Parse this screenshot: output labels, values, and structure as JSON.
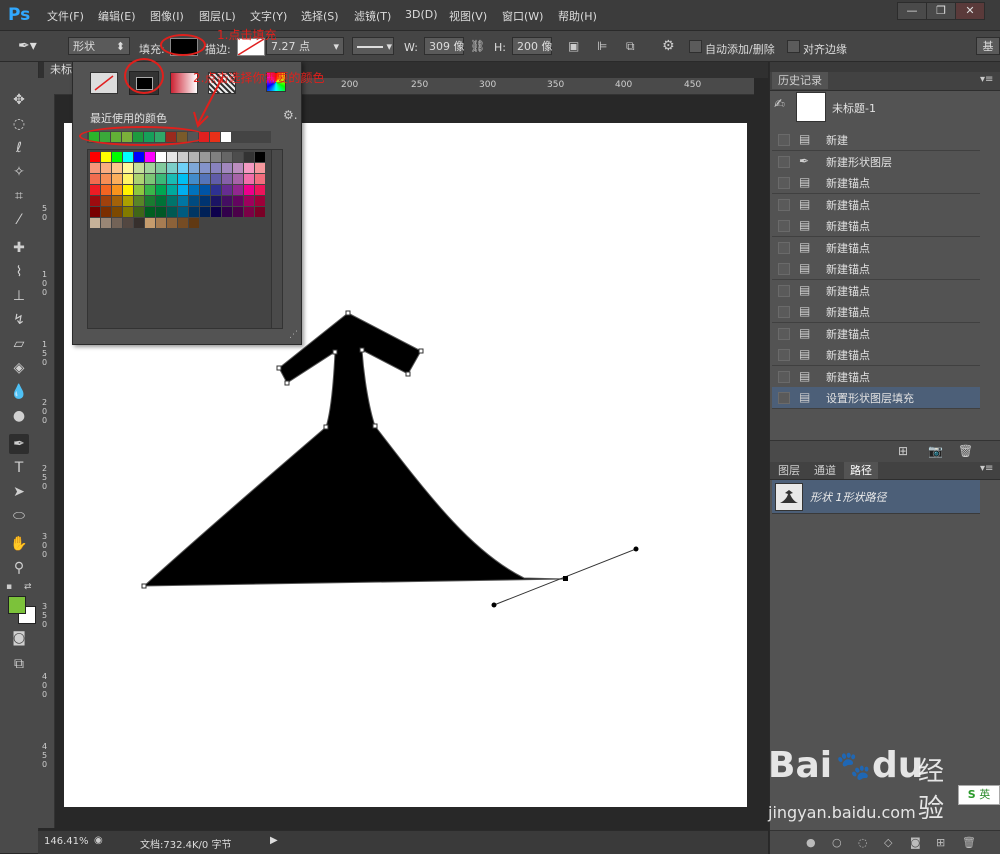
{
  "app": {
    "logo": "Ps"
  },
  "menu": [
    {
      "label": "文件(F)"
    },
    {
      "label": "编辑(E)"
    },
    {
      "label": "图像(I)"
    },
    {
      "label": "图层(L)"
    },
    {
      "label": "文字(Y)"
    },
    {
      "label": "选择(S)"
    },
    {
      "label": "滤镜(T)"
    },
    {
      "label": "3D(D)"
    },
    {
      "label": "视图(V)"
    },
    {
      "label": "窗口(W)"
    },
    {
      "label": "帮助(H)"
    }
  ],
  "window_buttons": {
    "minimize": "—",
    "restore": "❐",
    "close": "✕"
  },
  "options": {
    "mode": "形状",
    "fill_label": "填充:",
    "stroke_label": "描边:",
    "stroke_width": "7.27 点",
    "w_label": "W:",
    "w_value": "309 像",
    "h_label": "H:",
    "h_value": "200 像",
    "auto_add_delete": "自动添加/删除",
    "align_edges": "对齐边缘",
    "essentials": "基"
  },
  "document": {
    "tab_name": "未标"
  },
  "ruler": {
    "top_ticks": [
      "200",
      "250",
      "300",
      "350",
      "400",
      "450"
    ],
    "left_ticks": [
      "50",
      "100",
      "150",
      "200",
      "250",
      "300",
      "350",
      "400",
      "450"
    ]
  },
  "status": {
    "zoom": "146.41%",
    "doc_info": "文档:732.4K/0 字节"
  },
  "swatch_popup": {
    "recent_label": "最近使用的颜色",
    "recent_colors": [
      "#2bb42b",
      "#3aa83a",
      "#62b036",
      "#7bb03a",
      "#1e9a3e",
      "#16a05a",
      "#30a868",
      "#9a2a1e",
      "#7a5a2a",
      "#555555",
      "#e02020",
      "#e83018",
      "#ffffff"
    ],
    "grid_rows": [
      [
        "#ff0000",
        "#ffff00",
        "#00ff00",
        "#00ffff",
        "#0000ff",
        "#ff00ff",
        "#ffffff",
        "#e6e6e6",
        "#cccccc",
        "#b3b3b3",
        "#999999",
        "#808080",
        "#666666",
        "#4d4d4d",
        "#333333",
        "#000000"
      ],
      [
        "#f7977a",
        "#f9ad81",
        "#fdc68a",
        "#fff79a",
        "#c4df9b",
        "#a2d39c",
        "#82ca9d",
        "#7bcdc8",
        "#6ecff6",
        "#7ea7d8",
        "#8493ca",
        "#8882be",
        "#a187be",
        "#bc8dbf",
        "#f49ac2",
        "#f6989d"
      ],
      [
        "#f26c4f",
        "#f68e55",
        "#fbaf5c",
        "#fff467",
        "#acd372",
        "#7cc576",
        "#3bb878",
        "#1abbb4",
        "#00bff3",
        "#438ccb",
        "#5574b9",
        "#605ca8",
        "#8560a8",
        "#a763a8",
        "#f06eaa",
        "#f26d7d"
      ],
      [
        "#ed1c24",
        "#f26522",
        "#f7941d",
        "#fff200",
        "#8dc73f",
        "#39b54a",
        "#00a651",
        "#00a99d",
        "#00aeef",
        "#0072bc",
        "#0054a6",
        "#2e3192",
        "#662d91",
        "#92278f",
        "#ec008c",
        "#ed145b"
      ],
      [
        "#9e0b0f",
        "#a0410d",
        "#a36209",
        "#aba000",
        "#598527",
        "#1a7b30",
        "#007236",
        "#00746b",
        "#0076a3",
        "#004b80",
        "#003471",
        "#1b1464",
        "#440e62",
        "#630460",
        "#9e005d",
        "#9e0039"
      ],
      [
        "#790000",
        "#7b2e00",
        "#7d4900",
        "#827b00",
        "#406618",
        "#005e20",
        "#005826",
        "#005952",
        "#005b7f",
        "#003663",
        "#002157",
        "#0d004c",
        "#32004b",
        "#4b0049",
        "#7b0046",
        "#7a0026"
      ],
      [
        "#c7b299",
        "#998675",
        "#736357",
        "#534741",
        "#37302d",
        "#c69c6d",
        "#a67c52",
        "#8c6239",
        "#754c24",
        "#603913",
        "",
        "",
        "",
        "",
        "",
        ""
      ]
    ]
  },
  "annotations": {
    "step1": "1.点击填充",
    "step2": "2.点击选择你需要的颜色"
  },
  "history_panel": {
    "tab": "历史记录",
    "snapshot": "未标题-1",
    "items": [
      {
        "label": "新建",
        "icon": "doc-icon"
      },
      {
        "label": "新建形状图层",
        "icon": "pen-icon"
      },
      {
        "label": "新建锚点",
        "icon": "doc-icon"
      },
      {
        "label": "新建锚点",
        "icon": "doc-icon"
      },
      {
        "label": "新建锚点",
        "icon": "doc-icon"
      },
      {
        "label": "新建锚点",
        "icon": "doc-icon"
      },
      {
        "label": "新建锚点",
        "icon": "doc-icon"
      },
      {
        "label": "新建锚点",
        "icon": "doc-icon"
      },
      {
        "label": "新建锚点",
        "icon": "doc-icon"
      },
      {
        "label": "新建锚点",
        "icon": "doc-icon"
      },
      {
        "label": "新建锚点",
        "icon": "doc-icon"
      },
      {
        "label": "新建锚点",
        "icon": "doc-icon"
      },
      {
        "label": "设置形状图层填充",
        "icon": "doc-icon",
        "selected": true
      }
    ]
  },
  "layers_panel": {
    "tabs": [
      {
        "label": "图层"
      },
      {
        "label": "通道"
      },
      {
        "label": "路径"
      }
    ],
    "active_tab": "路径",
    "path_item": "形状 1形状路径"
  },
  "watermark": {
    "brand": "Bai",
    "brand2": "du",
    "jingyan": "经验",
    "url": "jingyan.baidu.com",
    "ime": "英"
  },
  "colors": {
    "accent": "#31a8ff",
    "annotation": "#e0201c",
    "selection": "#4c5f78"
  }
}
